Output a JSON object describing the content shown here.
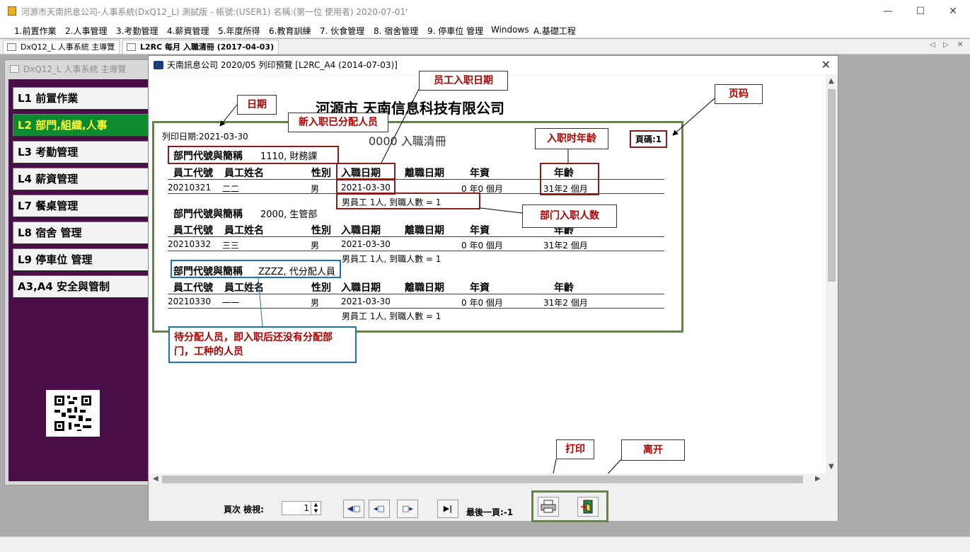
{
  "window": {
    "title": "河源市天南訊息公司-人事系統(DxQ12_L) 測試版 - 帳號:(USER1) 名稱:(第一位 使用者) 2020-07-01'"
  },
  "menu": [
    "1.前置作業",
    "2.人事管理",
    "3.考勤管理",
    "4.薪資管理",
    "5.年度所得",
    "6.教育訓練",
    "7. 伙食管理",
    "8. 宿舍管理",
    "9. 停車位 管理",
    "Windows",
    "A.基礎工程"
  ],
  "tabs": [
    "DxQ12_L 人事系統 主導覽",
    "L2RC 每月 入職清冊 (2017-04-03)"
  ],
  "nav": {
    "title": "DxQ12_L 人事系統 主導覽",
    "items": [
      "L1 前置作業",
      "L2 部門,組織,人事",
      "L3 考勤管理",
      "L4 薪資管理",
      "L7 餐桌管理",
      "L8 宿舍 管理",
      "L9 停車位 管理",
      "A3,A4 安全與管制"
    ],
    "active_index": 1
  },
  "preview": {
    "title": "天南訊息公司 2020/05 列印預覽 [L2RC_A4 (2014-07-03)]"
  },
  "report": {
    "company": "河源市 天南信息科技有限公司",
    "title": "0000 入職清冊",
    "print_date": "列印日期:2021-03-30",
    "page": "頁碼:1",
    "dept_label": "部門代號與簡稱",
    "columns": [
      "員工代號",
      "員工姓名",
      "性別",
      "入職日期",
      "離職日期",
      "年資",
      "年齡"
    ],
    "groups": [
      {
        "dept": "1110, 財務課",
        "row": {
          "id": "20210321",
          "name": "二二",
          "sex": "男",
          "hire": "2021-03-30",
          "seniority": "0 年0 個月",
          "age": "31年2 個月"
        },
        "summary": "男員工  1人, 到職人數 =    1"
      },
      {
        "dept": "2000, 生管部",
        "row": {
          "id": "20210332",
          "name": "三三",
          "sex": "男",
          "hire": "2021-03-30",
          "seniority": "0 年0 個月",
          "age": "31年2 個月"
        },
        "summary": "男員工  1人, 到職人數 =    1"
      },
      {
        "dept": "ZZZZ, 代分配人員",
        "row": {
          "id": "20210330",
          "name": "一一",
          "sex": "男",
          "hire": "2021-03-30",
          "seniority": "0 年0 個月",
          "age": "31年2 個月"
        },
        "summary": "男員工  1人, 到職人數 =    1"
      }
    ]
  },
  "callouts": {
    "date": "日期",
    "hire_date": "员工入职日期",
    "page_no": "页码",
    "assigned": "新入职已分配人员",
    "age_at_hire": "入职时年龄",
    "dept_count": "部门入职人数",
    "unassigned": "待分配人员，即入职后还没有分配部门，工种的人员",
    "print": "打印",
    "exit": "离开"
  },
  "toolbar": {
    "page_label": "頁次 檢視:",
    "page_value": "1",
    "last_page": "最後一頁:-1"
  }
}
